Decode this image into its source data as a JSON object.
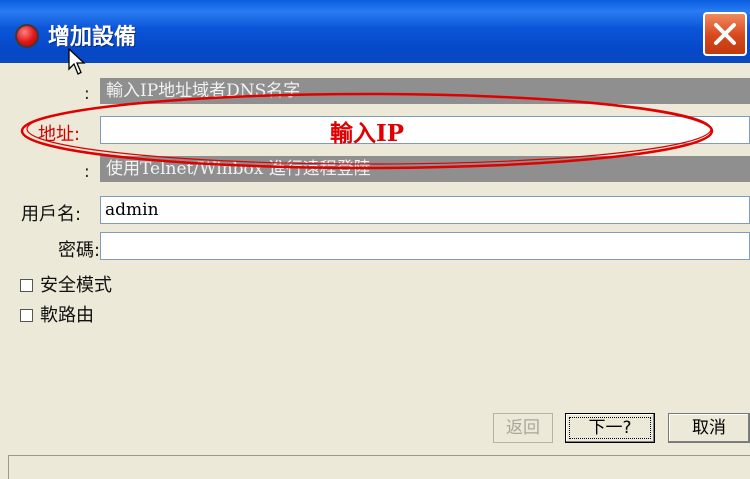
{
  "window": {
    "title": "增加設備",
    "icon": "red-orb-icon",
    "close_icon": "close-icon"
  },
  "hints": {
    "address_hint": "輸入IP地址域者DNS名字",
    "protocol_hint": "使用Telnet/Winbox 進行遠程登陸",
    "colon": ":"
  },
  "form": {
    "address_label": "地址:",
    "address_value": "",
    "username_label": "用戶名:",
    "username_value": "admin",
    "password_label": "密碼:",
    "password_value": ""
  },
  "annotation": {
    "text": "輸入IP",
    "color": "#e00000"
  },
  "options": [
    {
      "label": "安全模式",
      "checked": false
    },
    {
      "label": "軟路由",
      "checked": false
    }
  ],
  "buttons": {
    "back": "返回",
    "next": "下一?",
    "cancel": "取消"
  },
  "colors": {
    "titlebar": "#0548c8",
    "hint_bg": "#8f8f8f",
    "dialog_bg": "#ece9d8"
  }
}
